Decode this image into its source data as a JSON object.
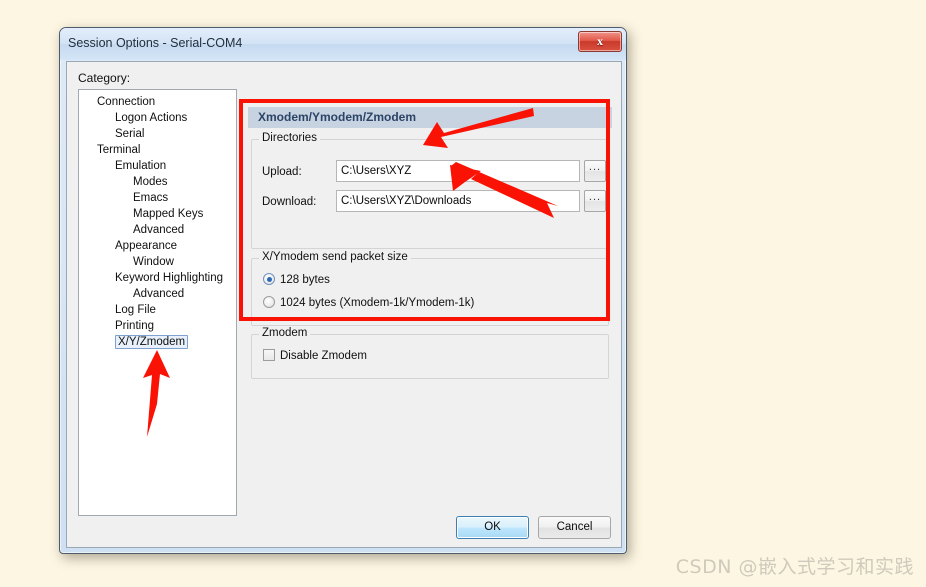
{
  "window": {
    "title": "Session Options - Serial-COM4",
    "close_label": "x"
  },
  "client": {
    "category_label": "Category:"
  },
  "tree": {
    "items": [
      {
        "label": "Connection",
        "indent": 0,
        "expander": "expanded",
        "selected": false
      },
      {
        "label": "Logon Actions",
        "indent": 1,
        "expander": "none",
        "selected": false
      },
      {
        "label": "Serial",
        "indent": 1,
        "expander": "none",
        "selected": false
      },
      {
        "label": "Terminal",
        "indent": 0,
        "expander": "expanded",
        "selected": false
      },
      {
        "label": "Emulation",
        "indent": 1,
        "expander": "expanded",
        "selected": false
      },
      {
        "label": "Modes",
        "indent": 2,
        "expander": "none",
        "selected": false
      },
      {
        "label": "Emacs",
        "indent": 2,
        "expander": "none",
        "selected": false
      },
      {
        "label": "Mapped Keys",
        "indent": 2,
        "expander": "none",
        "selected": false
      },
      {
        "label": "Advanced",
        "indent": 2,
        "expander": "none",
        "selected": false
      },
      {
        "label": "Appearance",
        "indent": 1,
        "expander": "expanded",
        "selected": false
      },
      {
        "label": "Window",
        "indent": 2,
        "expander": "none",
        "selected": false
      },
      {
        "label": "Keyword Highlighting",
        "indent": 1,
        "expander": "expanded",
        "selected": false
      },
      {
        "label": "Advanced",
        "indent": 2,
        "expander": "none",
        "selected": false
      },
      {
        "label": "Log File",
        "indent": 1,
        "expander": "none",
        "selected": false
      },
      {
        "label": "Printing",
        "indent": 1,
        "expander": "none",
        "selected": false
      },
      {
        "label": "X/Y/Zmodem",
        "indent": 1,
        "expander": "none",
        "selected": true
      }
    ]
  },
  "pane": {
    "header": "Xmodem/Ymodem/Zmodem",
    "directories": {
      "group_title": "Directories",
      "upload_label": "Upload:",
      "upload_value": "C:\\Users\\XYZ",
      "download_label": "Download:",
      "download_value": "C:\\Users\\XYZ\\Downloads",
      "browse_label": "..."
    },
    "packet": {
      "group_title": "X/Ymodem send packet size",
      "option_128": "128 bytes",
      "option_1024": "1024 bytes  (Xmodem-1k/Ymodem-1k)",
      "selected": "128"
    },
    "zmodem": {
      "group_title": "Zmodem",
      "disable_label": "Disable Zmodem",
      "disable_checked": false
    }
  },
  "buttons": {
    "ok": "OK",
    "cancel": "Cancel"
  },
  "annotations": {
    "highlight_color": "#fa1205",
    "arrow_count": 3
  },
  "watermark": {
    "text": "CSDN @嵌入式学习和实践"
  }
}
